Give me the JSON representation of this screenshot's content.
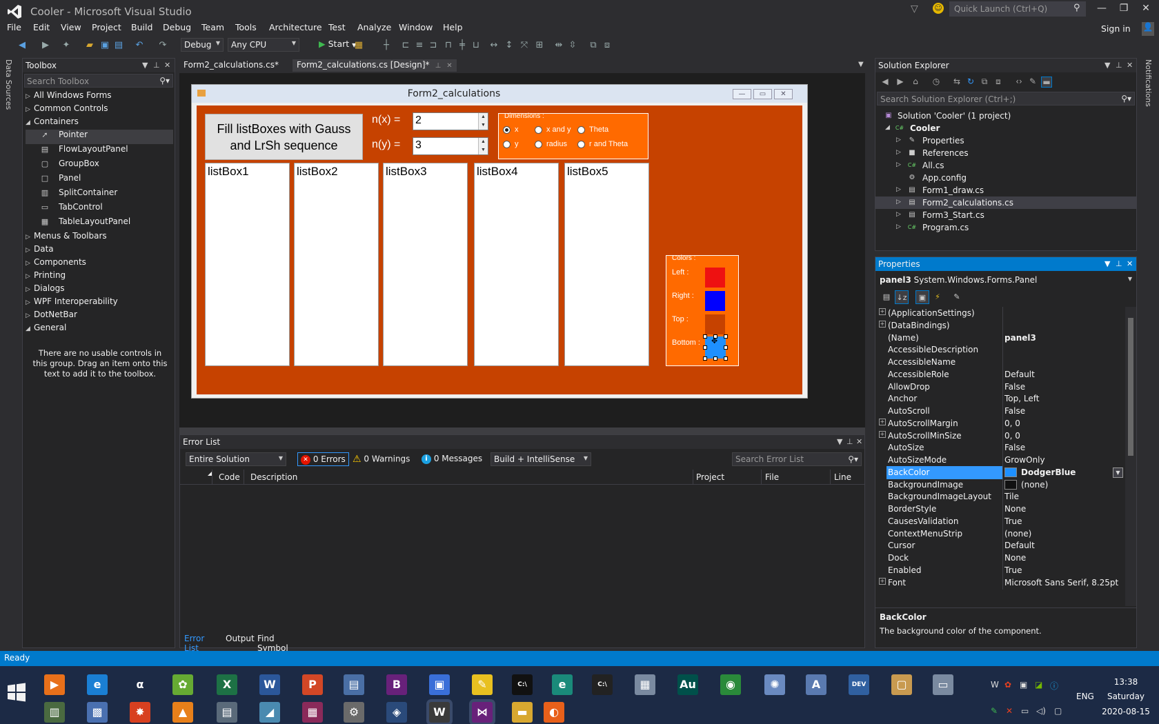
{
  "window": {
    "title": "Cooler - Microsoft Visual Studio",
    "quick_launch_placeholder": "Quick Launch (Ctrl+Q)",
    "sign_in": "Sign in"
  },
  "menu": [
    "File",
    "Edit",
    "View",
    "Project",
    "Build",
    "Debug",
    "Team",
    "Tools",
    "Architecture",
    "Test",
    "Analyze",
    "Window",
    "Help"
  ],
  "toolbar": {
    "config": "Debug",
    "platform": "Any CPU",
    "start_label": "Start"
  },
  "side_tabs": {
    "left": "Data Sources",
    "right": "Notifications"
  },
  "toolbox": {
    "title": "Toolbox",
    "search_placeholder": "Search Toolbox",
    "groups_top": [
      "All Windows Forms",
      "Common Controls",
      "Containers"
    ],
    "tools": [
      "Pointer",
      "FlowLayoutPanel",
      "GroupBox",
      "Panel",
      "SplitContainer",
      "TabControl",
      "TableLayoutPanel"
    ],
    "groups_bottom": [
      "Menus & Toolbars",
      "Data",
      "Components",
      "Printing",
      "Dialogs",
      "WPF Interoperability",
      "DotNetBar",
      "General"
    ],
    "empty_message": "There are no usable controls in this group. Drag an item onto this text to add it to the toolbox."
  },
  "doc_tabs": [
    {
      "label": "Form2_calculations.cs*"
    },
    {
      "label": "Form2_calculations.cs [Design]*"
    }
  ],
  "form": {
    "title": "Form2_calculations",
    "button_label": "Fill listBoxes with Gauss and LrSh sequence",
    "nx_label": "n(x) =",
    "nx_value": "2",
    "ny_label": "n(y) =",
    "ny_value": "3",
    "dimensions": {
      "title": "Dimensions :",
      "options": [
        "x",
        "x and y",
        "Theta",
        "y",
        "radius",
        "r and Theta"
      ],
      "selected": "x"
    },
    "listboxes": [
      "listBox1",
      "listBox2",
      "listBox3",
      "listBox4",
      "listBox5"
    ],
    "colors": {
      "title": "Colors :",
      "labels": [
        "Left :",
        "Right :",
        "Top :",
        "Bottom :"
      ],
      "values": [
        "#ee1111",
        "#0000ff",
        "#c64200",
        "#1e90ff"
      ]
    },
    "background_color": "#c64200"
  },
  "error_list": {
    "title": "Error List",
    "scope": "Entire Solution",
    "errors": "0 Errors",
    "warnings": "0 Warnings",
    "messages": "0 Messages",
    "source": "Build + IntelliSense",
    "search_placeholder": "Search Error List",
    "columns": [
      "Code",
      "Description",
      "Project",
      "File",
      "Line"
    ],
    "tabs": [
      "Error List",
      "Output",
      "Find Symbol Results"
    ]
  },
  "solution_explorer": {
    "title": "Solution Explorer",
    "search_placeholder": "Search Solution Explorer (Ctrl+;)",
    "solution": "Solution 'Cooler' (1 project)",
    "project": "Cooler",
    "items": [
      "Properties",
      "References",
      "All.cs",
      "App.config",
      "Form1_draw.cs",
      "Form2_calculations.cs",
      "Form3_Start.cs",
      "Program.cs"
    ],
    "selected": "Form2_calculations.cs"
  },
  "properties": {
    "title": "Properties",
    "object_name": "panel3",
    "object_type": "System.Windows.Forms.Panel",
    "rows": [
      {
        "name": "(ApplicationSettings)",
        "value": "",
        "expandable": true
      },
      {
        "name": "(DataBindings)",
        "value": "",
        "expandable": true
      },
      {
        "name": "(Name)",
        "value": "panel3",
        "bold": true
      },
      {
        "name": "AccessibleDescription",
        "value": ""
      },
      {
        "name": "AccessibleName",
        "value": ""
      },
      {
        "name": "AccessibleRole",
        "value": "Default"
      },
      {
        "name": "AllowDrop",
        "value": "False"
      },
      {
        "name": "Anchor",
        "value": "Top, Left"
      },
      {
        "name": "AutoScroll",
        "value": "False"
      },
      {
        "name": "AutoScrollMargin",
        "value": "0, 0",
        "expandable": true
      },
      {
        "name": "AutoScrollMinSize",
        "value": "0, 0",
        "expandable": true
      },
      {
        "name": "AutoSize",
        "value": "False"
      },
      {
        "name": "AutoSizeMode",
        "value": "GrowOnly"
      },
      {
        "name": "BackColor",
        "value": "DodgerBlue",
        "swatch": "#1e90ff",
        "selected": true,
        "bold": true
      },
      {
        "name": "BackgroundImage",
        "value": "(none)",
        "swatch": "#111111"
      },
      {
        "name": "BackgroundImageLayout",
        "value": "Tile"
      },
      {
        "name": "BorderStyle",
        "value": "None"
      },
      {
        "name": "CausesValidation",
        "value": "True"
      },
      {
        "name": "ContextMenuStrip",
        "value": "(none)"
      },
      {
        "name": "Cursor",
        "value": "Default"
      },
      {
        "name": "Dock",
        "value": "None"
      },
      {
        "name": "Enabled",
        "value": "True"
      },
      {
        "name": "Font",
        "value": "Microsoft Sans Serif, 8.25pt",
        "expandable": true
      }
    ],
    "description_title": "BackColor",
    "description_text": "The background color of the component."
  },
  "status": "Ready",
  "taskbar": {
    "apps": [
      {
        "name": "media-player-icon",
        "glyph": "▶",
        "color": "#e8701a"
      },
      {
        "name": "internet-explorer-icon",
        "glyph": "e",
        "color": "#1a7fd4"
      },
      {
        "name": "alpha-app-icon",
        "glyph": "α",
        "color": "#1c2a45"
      },
      {
        "name": "film-reel-icon",
        "glyph": "✿",
        "color": "#6a3"
      },
      {
        "name": "excel-icon",
        "glyph": "X",
        "color": "#1d7145"
      },
      {
        "name": "word-icon",
        "glyph": "W",
        "color": "#2b579a"
      },
      {
        "name": "powerpoint-icon",
        "glyph": "P",
        "color": "#d24726"
      },
      {
        "name": "document-app-icon",
        "glyph": "▤",
        "color": "#4a6fa5"
      },
      {
        "name": "visual-studio-blend-icon",
        "glyph": "B",
        "color": "#68217a"
      },
      {
        "name": "window-app-icon",
        "glyph": "▣",
        "color": "#3a6fd8"
      },
      {
        "name": "paint-tool-icon",
        "glyph": "✎",
        "color": "#e8c020"
      },
      {
        "name": "terminal-icon",
        "glyph": "C:\\",
        "color": "#111"
      },
      {
        "name": "edge-app-icon",
        "glyph": "e",
        "color": "#1a8a7a"
      },
      {
        "name": "command-prompt-icon",
        "glyph": "C:\\",
        "color": "#222"
      },
      {
        "name": "calculator-icon",
        "glyph": "▦",
        "color": "#7a8aa0"
      },
      {
        "name": "audition-icon",
        "glyph": "Au",
        "color": "#00504a"
      },
      {
        "name": "globe-app-icon",
        "glyph": "◉",
        "color": "#2a8a3a"
      },
      {
        "name": "paint-palette-icon",
        "glyph": "✺",
        "color": "#6a8ac0"
      },
      {
        "name": "font-viewer-icon",
        "glyph": "A",
        "color": "#5a7ab0"
      },
      {
        "name": "dev-cpp-icon",
        "glyph": "DEV",
        "color": "#3060a0"
      },
      {
        "name": "notes-app-icon",
        "glyph": "▢",
        "color": "#c89a50"
      },
      {
        "name": "monitor-app-icon",
        "glyph": "▭",
        "color": "#7a8aa0"
      },
      {
        "name": "taskbar-app-row2-1",
        "glyph": "▥",
        "color": "#4a6a40"
      },
      {
        "name": "network-app-icon",
        "glyph": "▩",
        "color": "#4a70b0"
      },
      {
        "name": "explosion-app-icon",
        "glyph": "✸",
        "color": "#d84020"
      },
      {
        "name": "vlc-icon",
        "glyph": "▲",
        "color": "#e8801a"
      },
      {
        "name": "window-tile-icon",
        "glyph": "▤",
        "color": "#5a6a7a"
      },
      {
        "name": "pen-app-icon",
        "glyph": "◢",
        "color": "#4a8ab0"
      },
      {
        "name": "winrar-icon",
        "glyph": "▦",
        "color": "#8a2a5a"
      },
      {
        "name": "gear-app-icon",
        "glyph": "⚙",
        "color": "#6a6a6a"
      },
      {
        "name": "video-app-icon",
        "glyph": "◈",
        "color": "#2a4a7a"
      },
      {
        "name": "wps-icon",
        "glyph": "W",
        "color": "#3a3a3a"
      },
      {
        "name": "visual-studio-icon",
        "glyph": "⋈",
        "color": "#68217a"
      },
      {
        "name": "file-explorer-icon",
        "glyph": "▬",
        "color": "#d8a830"
      },
      {
        "name": "firefox-icon",
        "glyph": "◐",
        "color": "#e8601a"
      }
    ],
    "lang": "ENG",
    "time": "13:38",
    "day": "Saturday",
    "date": "2020-08-15"
  }
}
